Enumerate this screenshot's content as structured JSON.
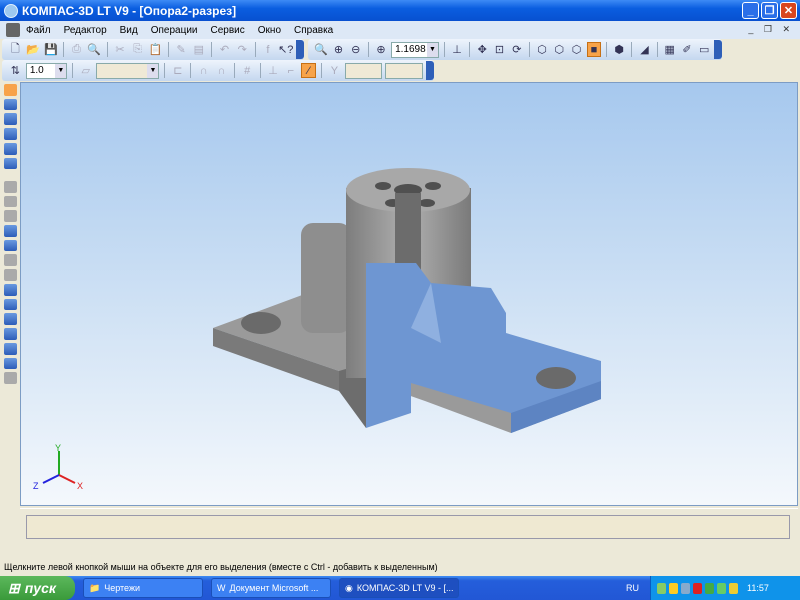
{
  "window": {
    "title": "КОМПАС-3D LT V9 - [Опора2-разрез]",
    "min": "_",
    "max": "❐",
    "close": "✕"
  },
  "menu": [
    "Файл",
    "Редактор",
    "Вид",
    "Операции",
    "Сервис",
    "Окно",
    "Справка"
  ],
  "mdi_buttons": "_ ❐ ✕",
  "toolbar": {
    "zoom_value": "1.1698",
    "step_value": "1.0"
  },
  "axes": {
    "x": "X",
    "y": "Y",
    "z": "Z"
  },
  "status_text": "Щелкните левой кнопкой мыши на объекте для его выделения (вместе с Ctrl - добавить к выделенным)",
  "taskbar": {
    "start": "пуск",
    "tasks": [
      "Чертежи",
      "Документ Microsoft ...",
      "КОМПАС-3D LT V9 - [..."
    ],
    "lang": "RU",
    "clock": "11:57"
  },
  "colors": {
    "accent": "#f7a34a",
    "section": "#6e96d2",
    "body": "#8a8a8a"
  }
}
